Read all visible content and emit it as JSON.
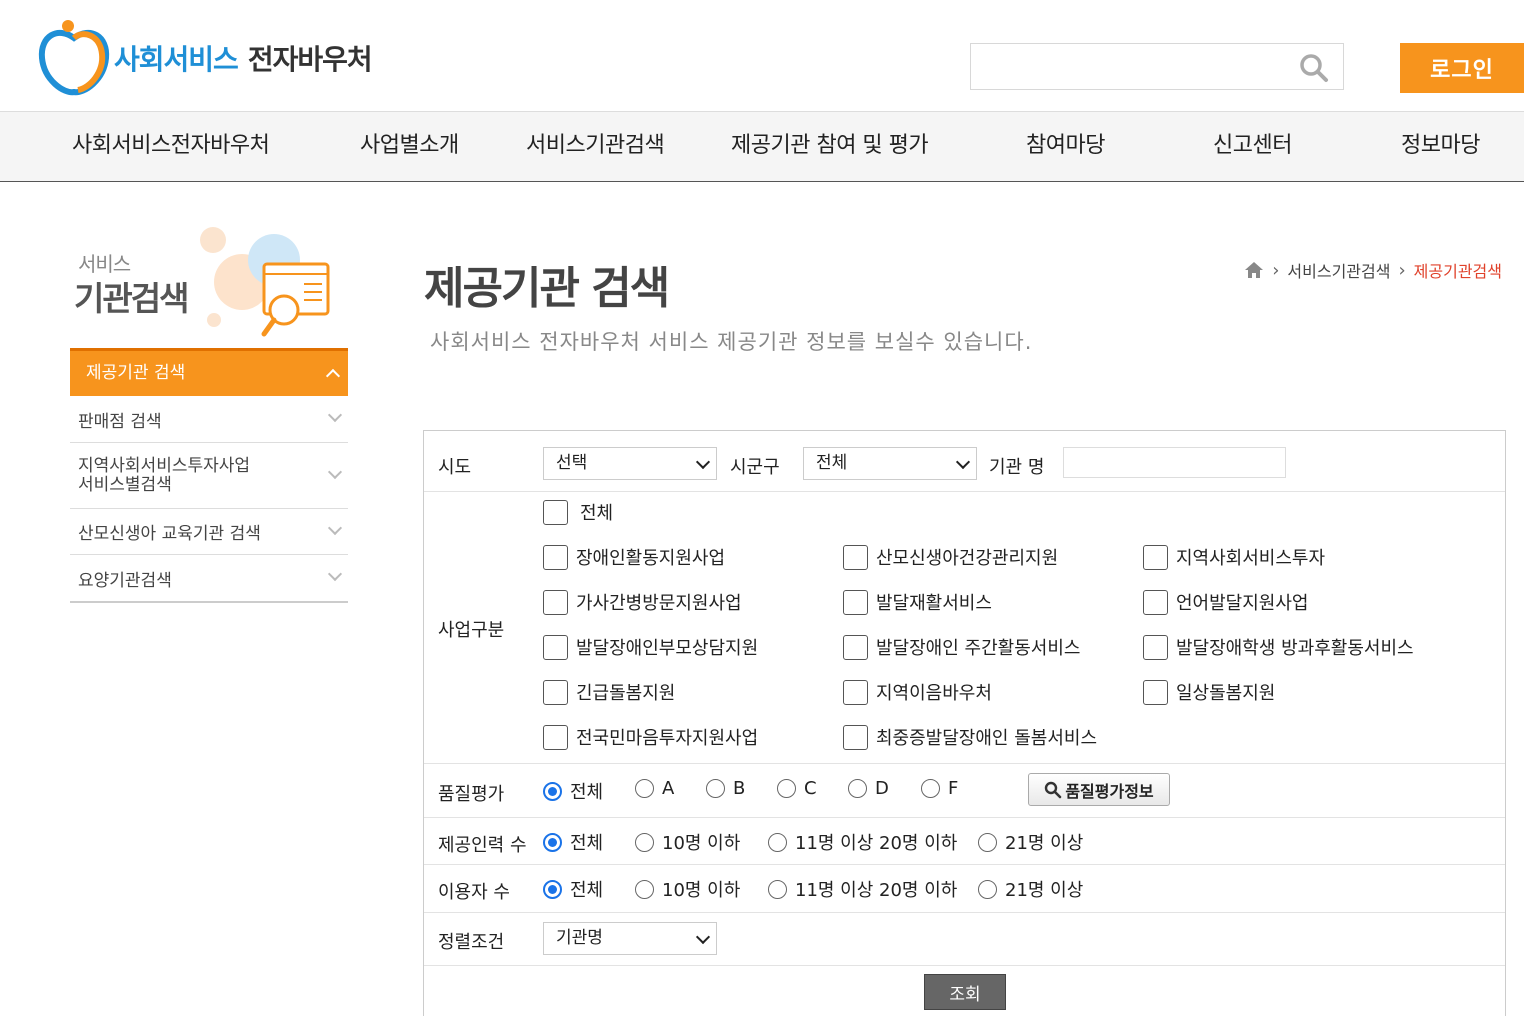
{
  "header": {
    "logo_main": "사회서비스",
    "logo_sub": "전자바우처",
    "search_placeholder": "",
    "login_label": "로그인"
  },
  "gnb": [
    "사회서비스전자바우처",
    "사업별소개",
    "서비스기관검색",
    "제공기관 참여 및 평가",
    "참여마당",
    "신고센터",
    "정보마당"
  ],
  "lnb": {
    "title_small": "서비스",
    "title_big": "기관검색",
    "active": "제공기관 검색",
    "items": [
      {
        "line1": "판매점 검색",
        "line2": ""
      },
      {
        "line1": "지역사회서비스투자사업",
        "line2": "서비스별검색"
      },
      {
        "line1": "산모신생아 교육기관 검색",
        "line2": ""
      },
      {
        "line1": "요양기관검색",
        "line2": ""
      }
    ]
  },
  "page": {
    "title": "제공기관 검색",
    "description": "사회서비스 전자바우처 서비스 제공기관 정보를 보실수 있습니다.",
    "breadcrumb": [
      "서비스기관검색",
      "제공기관검색"
    ]
  },
  "form": {
    "sido_label": "시도",
    "sido_value": "선택",
    "sigungu_label": "시군구",
    "sigungu_value": "전체",
    "org_name_label": "기관 명",
    "org_name_value": "",
    "business_label": "사업구분",
    "business_all": "전체",
    "business_items": [
      "장애인활동지원사업",
      "산모신생아건강관리지원",
      "지역사회서비스투자",
      "가사간병방문지원사업",
      "발달재활서비스",
      "언어발달지원사업",
      "발달장애인부모상담지원",
      "발달장애인 주간활동서비스",
      "발달장애학생 방과후활동서비스",
      "긴급돌봄지원",
      "지역이음바우처",
      "일상돌봄지원",
      "전국민마음투자지원사업",
      "최중증발달장애인 돌봄서비스"
    ],
    "quality_label": "품질평가",
    "quality_options": [
      "전체",
      "A",
      "B",
      "C",
      "D",
      "F"
    ],
    "quality_selected": "전체",
    "quality_info_label": "품질평가정보",
    "staff_label": "제공인력 수",
    "staff_options": [
      "전체",
      "10명 이하",
      "11명 이상 20명 이하",
      "21명 이상"
    ],
    "users_label": "이용자 수",
    "users_options": [
      "전체",
      "10명 이하",
      "11명 이상 20명 이하",
      "21명 이상"
    ],
    "sort_label": "정렬조건",
    "sort_value": "기관명",
    "submit_label": "조회"
  },
  "colors": {
    "accent": "#f7941d",
    "brand_blue": "#1f8fd6",
    "breadcrumb_current": "#e0412a",
    "radio_on": "#1a73e8"
  }
}
